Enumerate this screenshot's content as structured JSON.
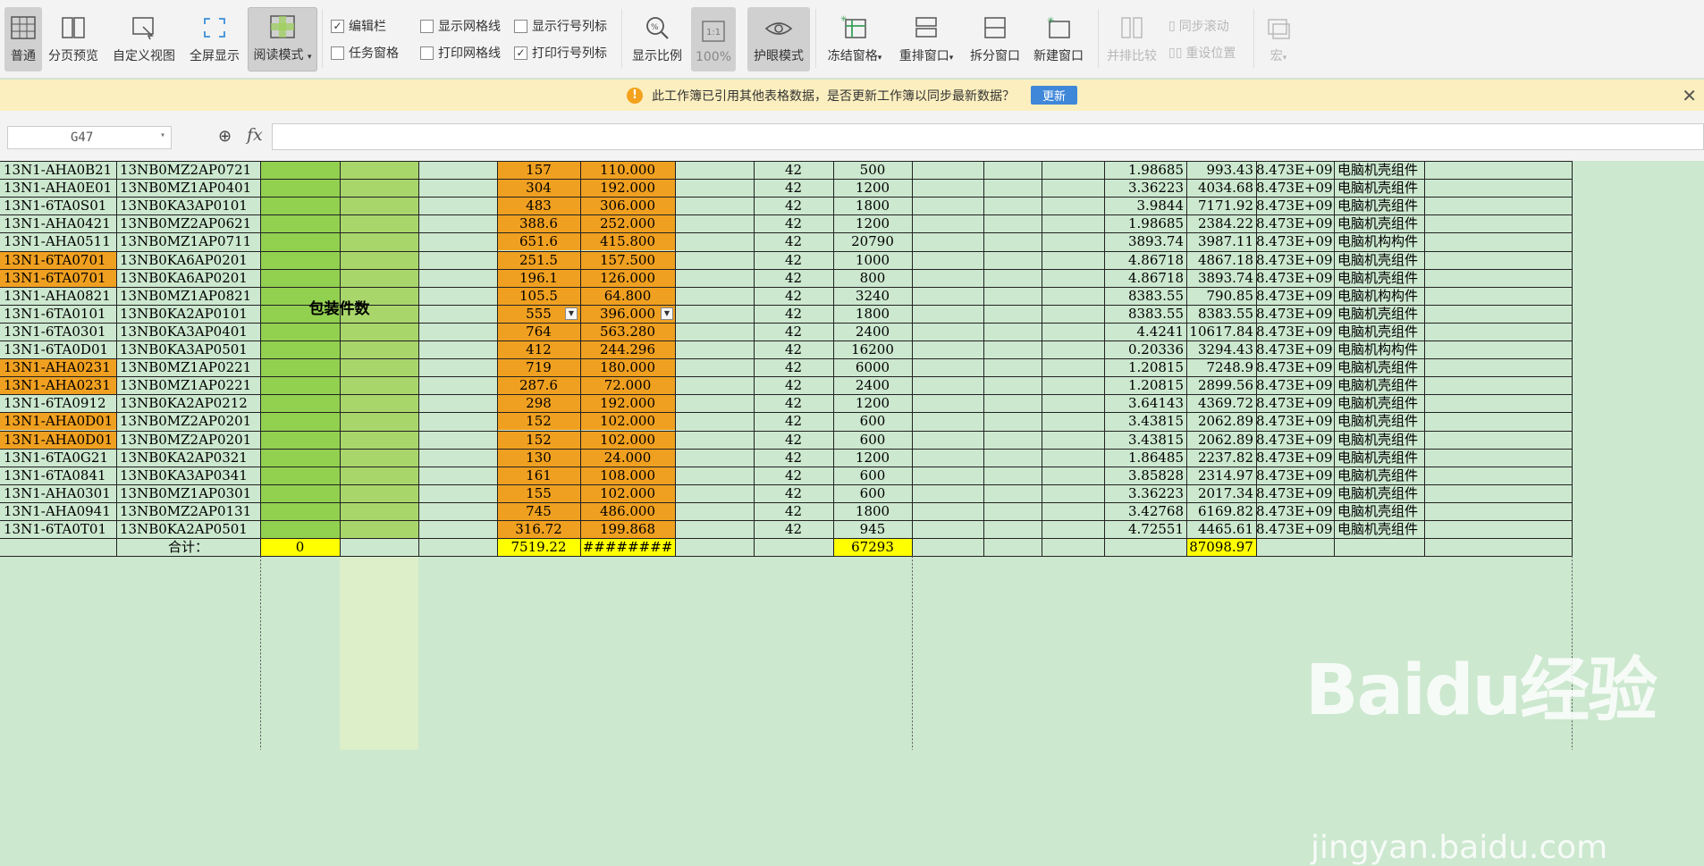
{
  "ribbon": {
    "normal": "普通",
    "page_break": "分页预览",
    "custom_view": "自定义视图",
    "full_screen": "全屏显示",
    "reading_mode": "阅读模式",
    "edit_bar": "编辑栏",
    "task_pane": "任务窗格",
    "show_gridlines": "显示网格线",
    "print_gridlines": "打印网格线",
    "show_headers": "显示行号列标",
    "print_headers": "打印行号列标",
    "zoom": "显示比例",
    "zoom_100": "100%",
    "eye_mode": "护眼模式",
    "freeze": "冻结窗格",
    "arrange": "重排窗口",
    "split": "拆分窗口",
    "new_window": "新建窗口",
    "side_by_side": "并排比较",
    "sync_scroll": "同步滚动",
    "reset_position": "重设位置",
    "macro": "宏"
  },
  "notice": {
    "message": "此工作簿已引用其他表格数据，是否更新工作簿以同步最新数据？",
    "update_button": "更新"
  },
  "formula_bar": {
    "cell_ref": "G47",
    "fx": "fx",
    "formula": ""
  },
  "sheet": {
    "merged_label": "包装件数",
    "total_label": "合计：",
    "totals": {
      "c": "0",
      "f": "7519.22",
      "g": "########",
      "j": "67293",
      "o": "87098.97"
    },
    "rows": [
      {
        "a": "13N1-AHA0B21",
        "b": "13NB0MZ2AP0721",
        "f": "157",
        "g": "110.000",
        "i": "42",
        "j": "500",
        "n": "1.98685",
        "o": "993.43",
        "p": "8.473E+09",
        "q": "电脑机壳组件",
        "hl": false
      },
      {
        "a": "13N1-AHA0E01",
        "b": "13NB0MZ1AP0401",
        "f": "304",
        "g": "192.000",
        "i": "42",
        "j": "1200",
        "n": "3.36223",
        "o": "4034.68",
        "p": "8.473E+09",
        "q": "电脑机壳组件",
        "hl": false
      },
      {
        "a": "13N1-6TA0S01",
        "b": "13NB0KA3AP0101",
        "f": "483",
        "g": "306.000",
        "i": "42",
        "j": "1800",
        "n": "3.9844",
        "o": "7171.92",
        "p": "8.473E+09",
        "q": "电脑机壳组件",
        "hl": false
      },
      {
        "a": "13N1-AHA0421",
        "b": "13NB0MZ2AP0621",
        "f": "388.6",
        "g": "252.000",
        "i": "42",
        "j": "1200",
        "n": "1.98685",
        "o": "2384.22",
        "p": "8.473E+09",
        "q": "电脑机壳组件",
        "hl": false
      },
      {
        "a": "13N1-AHA0511",
        "b": "13NB0MZ1AP0711",
        "f": "651.6",
        "g": "415.800",
        "i": "42",
        "j": "20790",
        "n": "3893.74",
        "o": "3987.11",
        "p": "8.473E+09",
        "q": "电脑机构构件",
        "hl": false
      },
      {
        "a": "13N1-6TA0701",
        "b": "13NB0KA6AP0201",
        "f": "251.5",
        "g": "157.500",
        "i": "42",
        "j": "1000",
        "n": "4.86718",
        "o": "4867.18",
        "p": "8.473E+09",
        "q": "电脑机壳组件",
        "hl": true
      },
      {
        "a": "13N1-6TA0701",
        "b": "13NB0KA6AP0201",
        "f": "196.1",
        "g": "126.000",
        "i": "42",
        "j": "800",
        "n": "4.86718",
        "o": "3893.74",
        "p": "8.473E+09",
        "q": "电脑机壳组件",
        "hl": true
      },
      {
        "a": "13N1-AHA0821",
        "b": "13NB0MZ1AP0821",
        "f": "105.5",
        "g": "64.800",
        "i": "42",
        "j": "3240",
        "n": "8383.55",
        "o": "790.85",
        "p": "8.473E+09",
        "q": "电脑机构构件",
        "hl": false
      },
      {
        "a": "13N1-6TA0101",
        "b": "13NB0KA2AP0101",
        "f": "555",
        "g": "396.000",
        "i": "42",
        "j": "1800",
        "n": "8383.55",
        "o": "8383.55",
        "p": "8.473E+09",
        "q": "电脑机壳组件",
        "hl": false
      },
      {
        "a": "13N1-6TA0301",
        "b": "13NB0KA3AP0401",
        "f": "764",
        "g": "563.280",
        "i": "42",
        "j": "2400",
        "n": "4.4241",
        "o": "10617.84",
        "p": "8.473E+09",
        "q": "电脑机壳组件",
        "hl": false
      },
      {
        "a": "13N1-6TA0D01",
        "b": "13NB0KA3AP0501",
        "f": "412",
        "g": "244.296",
        "i": "42",
        "j": "16200",
        "n": "0.20336",
        "o": "3294.43",
        "p": "8.473E+09",
        "q": "电脑机构构件",
        "hl": false
      },
      {
        "a": "13N1-AHA0231",
        "b": "13NB0MZ1AP0221",
        "f": "719",
        "g": "180.000",
        "i": "42",
        "j": "6000",
        "n": "1.20815",
        "o": "7248.9",
        "p": "8.473E+09",
        "q": "电脑机壳组件",
        "hl": true
      },
      {
        "a": "13N1-AHA0231",
        "b": "13NB0MZ1AP0221",
        "f": "287.6",
        "g": "72.000",
        "i": "42",
        "j": "2400",
        "n": "1.20815",
        "o": "2899.56",
        "p": "8.473E+09",
        "q": "电脑机壳组件",
        "hl": true
      },
      {
        "a": "13N1-6TA0912",
        "b": "13NB0KA2AP0212",
        "f": "298",
        "g": "192.000",
        "i": "42",
        "j": "1200",
        "n": "3.64143",
        "o": "4369.72",
        "p": "8.473E+09",
        "q": "电脑机壳组件",
        "hl": false
      },
      {
        "a": "13N1-AHA0D01",
        "b": "13NB0MZ2AP0201",
        "f": "152",
        "g": "102.000",
        "i": "42",
        "j": "600",
        "n": "3.43815",
        "o": "2062.89",
        "p": "8.473E+09",
        "q": "电脑机壳组件",
        "hl": true
      },
      {
        "a": "13N1-AHA0D01",
        "b": "13NB0MZ2AP0201",
        "f": "152",
        "g": "102.000",
        "i": "42",
        "j": "600",
        "n": "3.43815",
        "o": "2062.89",
        "p": "8.473E+09",
        "q": "电脑机壳组件",
        "hl": true
      },
      {
        "a": "13N1-6TA0G21",
        "b": "13NB0KA2AP0321",
        "f": "130",
        "g": "24.000",
        "i": "42",
        "j": "1200",
        "n": "1.86485",
        "o": "2237.82",
        "p": "8.473E+09",
        "q": "电脑机壳组件",
        "hl": false
      },
      {
        "a": "13N1-6TA0841",
        "b": "13NB0KA3AP0341",
        "f": "161",
        "g": "108.000",
        "i": "42",
        "j": "600",
        "n": "3.85828",
        "o": "2314.97",
        "p": "8.473E+09",
        "q": "电脑机壳组件",
        "hl": false
      },
      {
        "a": "13N1-AHA0301",
        "b": "13NB0MZ1AP0301",
        "f": "155",
        "g": "102.000",
        "i": "42",
        "j": "600",
        "n": "3.36223",
        "o": "2017.34",
        "p": "8.473E+09",
        "q": "电脑机壳组件",
        "hl": false
      },
      {
        "a": "13N1-AHA0941",
        "b": "13NB0MZ2AP0131",
        "f": "745",
        "g": "486.000",
        "i": "42",
        "j": "1800",
        "n": "3.42768",
        "o": "6169.82",
        "p": "8.473E+09",
        "q": "电脑机壳组件",
        "hl": false
      },
      {
        "a": "13N1-6TA0T01",
        "b": "13NB0KA2AP0501",
        "f": "316.72",
        "g": "199.868",
        "i": "42",
        "j": "945",
        "n": "4.72551",
        "o": "4465.61",
        "p": "8.473E+09",
        "q": "电脑机壳组件",
        "hl": false
      }
    ]
  },
  "colors": {
    "sheet_bg": "#cce8cf",
    "merged_c": "#92d050",
    "merged_d": "#a9d66b",
    "orange": "#f0a020",
    "yellow": "#ffff00"
  },
  "watermark": {
    "logo": "Baidu经验",
    "url": "jingyan.baidu.com"
  }
}
